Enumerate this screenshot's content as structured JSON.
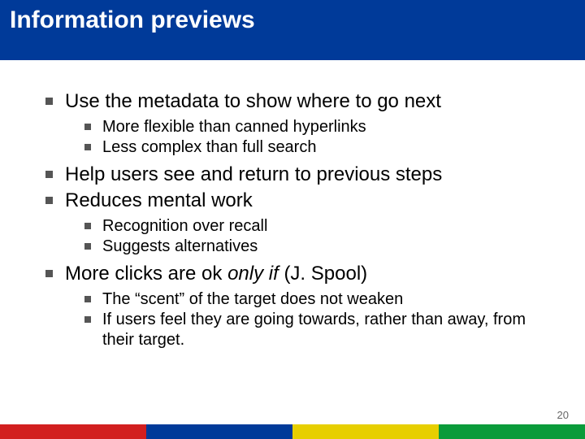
{
  "title": "Information previews",
  "bullets": [
    {
      "text": "Use the metadata to show where to go next",
      "sub": [
        "More flexible than canned hyperlinks",
        "Less complex than full search"
      ]
    },
    {
      "text": "Help users see and return to previous steps",
      "sub": []
    },
    {
      "text": "Reduces mental work",
      "sub": [
        "Recognition over recall",
        "Suggests alternatives"
      ]
    },
    {
      "text_html": "More clicks are ok <span class=\"ital\">only if</span> <span class=\"nonital\">(J. Spool)</span>",
      "sub": [
        "The “scent” of the target does not weaken",
        "If users feel they are going towards, rather than away, from their target."
      ]
    }
  ],
  "page_number": "20"
}
